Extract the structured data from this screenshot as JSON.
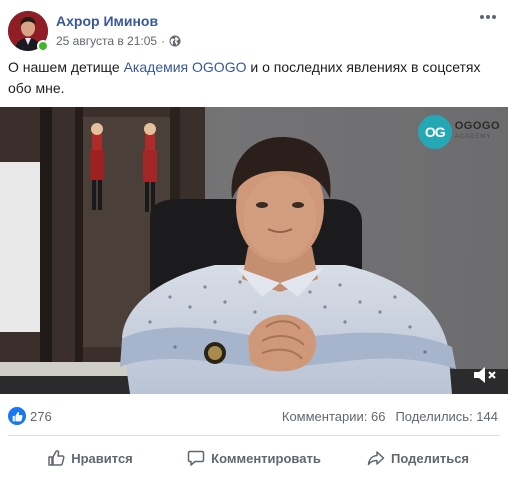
{
  "post": {
    "author": "Ахрор Иминов",
    "date": "25 августа в 21:05",
    "separator": "·",
    "text_before": "О нашем детище ",
    "link_text": "Академия OGOGO",
    "text_after": " и о последних явлениях в соцсетях обо мне."
  },
  "video": {
    "logo_mark": "OG",
    "logo_line1": "OGOGO",
    "logo_line2": "ACADEMY"
  },
  "reactions": {
    "count": "276",
    "comments": "Комментарии: 66",
    "shares": "Поделились: 144"
  },
  "actions": {
    "like": "Нравится",
    "comment": "Комментировать",
    "share": "Поделиться"
  },
  "icons": [
    "globe-icon",
    "more-options-icon",
    "like-reaction-icon",
    "mute-icon",
    "thumbs-up-icon",
    "comment-icon",
    "share-icon"
  ],
  "colors": {
    "link": "#385898",
    "like_blue": "#1877f2",
    "online": "#42b72a",
    "logo_teal": "#24a8b6"
  }
}
